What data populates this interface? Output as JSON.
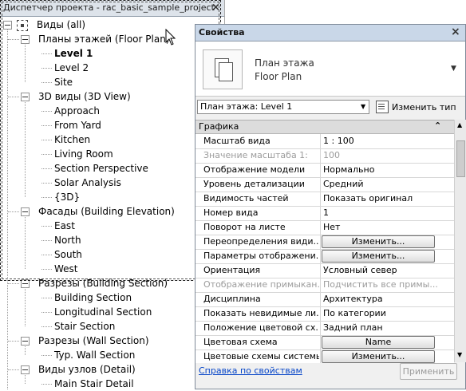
{
  "project_browser": {
    "title": "Диспетчер проекта - rac_basic_sample_project",
    "close_glyph": "×",
    "tree": [
      {
        "label": "Виды (all)",
        "level": 0,
        "toggle": true,
        "root": true
      },
      {
        "label": "Планы этажей (Floor Plan)",
        "level": 1,
        "toggle": true
      },
      {
        "label": "Level 1",
        "level": 2,
        "bold": true
      },
      {
        "label": "Level 2",
        "level": 2
      },
      {
        "label": "Site",
        "level": 2
      },
      {
        "label": "3D виды (3D View)",
        "level": 1,
        "toggle": true
      },
      {
        "label": "Approach",
        "level": 2
      },
      {
        "label": "From Yard",
        "level": 2
      },
      {
        "label": "Kitchen",
        "level": 2
      },
      {
        "label": "Living Room",
        "level": 2
      },
      {
        "label": "Section Perspective",
        "level": 2
      },
      {
        "label": "Solar Analysis",
        "level": 2
      },
      {
        "label": "{3D}",
        "level": 2
      },
      {
        "label": "Фасады (Building Elevation)",
        "level": 1,
        "toggle": true
      },
      {
        "label": "East",
        "level": 2
      },
      {
        "label": "North",
        "level": 2
      },
      {
        "label": "South",
        "level": 2
      },
      {
        "label": "West",
        "level": 2
      },
      {
        "label": "Разрезы (Building Section)",
        "level": 1,
        "toggle": true
      },
      {
        "label": "Building Section",
        "level": 2
      },
      {
        "label": "Longitudinal Section",
        "level": 2
      },
      {
        "label": "Stair Section",
        "level": 2
      },
      {
        "label": "Разрезы (Wall Section)",
        "level": 1,
        "toggle": true
      },
      {
        "label": "Typ. Wall Section",
        "level": 2
      },
      {
        "label": "Виды узлов (Detail)",
        "level": 1,
        "toggle": true
      },
      {
        "label": "Main Stair Detail",
        "level": 2
      }
    ]
  },
  "properties": {
    "title": "Свойства",
    "close_glyph": "×",
    "type_selector": {
      "line1": "План этажа",
      "line2": "Floor Plan",
      "icon": "floor-plan-icon"
    },
    "instance_dropdown": "План этажа: Level 1",
    "edit_type_label": "Изменить тип",
    "category": "Графика",
    "collapse_glyph": "⌃",
    "rows": [
      {
        "k": "Масштаб вида",
        "v": "1 : 100"
      },
      {
        "k": "Значение масштаба    1:",
        "v": "100",
        "dim": true
      },
      {
        "k": "Отображение модели",
        "v": "Нормально"
      },
      {
        "k": "Уровень детализации",
        "v": "Средний"
      },
      {
        "k": "Видимость частей",
        "v": "Показать оригинал"
      },
      {
        "k": "Номер вида",
        "v": "1"
      },
      {
        "k": "Поворот на листе",
        "v": "Нет"
      },
      {
        "k": "Переопределения види...",
        "v": "Изменить...",
        "button": true
      },
      {
        "k": "Параметры отображени...",
        "v": "Изменить...",
        "button": true
      },
      {
        "k": "Ориентация",
        "v": "Условный север"
      },
      {
        "k": "Отображение примыкан...",
        "v": "Подчистить все примы...",
        "dim": true
      },
      {
        "k": "Дисциплина",
        "v": "Архитектура"
      },
      {
        "k": "Показать невидимые ли...",
        "v": "По категории"
      },
      {
        "k": "Положение цветовой сх...",
        "v": "Задний план"
      },
      {
        "k": "Цветовая схема",
        "v": "Name",
        "button": true
      },
      {
        "k": "Цветовые схемы системы",
        "v": "Изменить...",
        "button": true
      }
    ],
    "help_link": "Справка по свойствам",
    "apply_label": "Применить"
  }
}
